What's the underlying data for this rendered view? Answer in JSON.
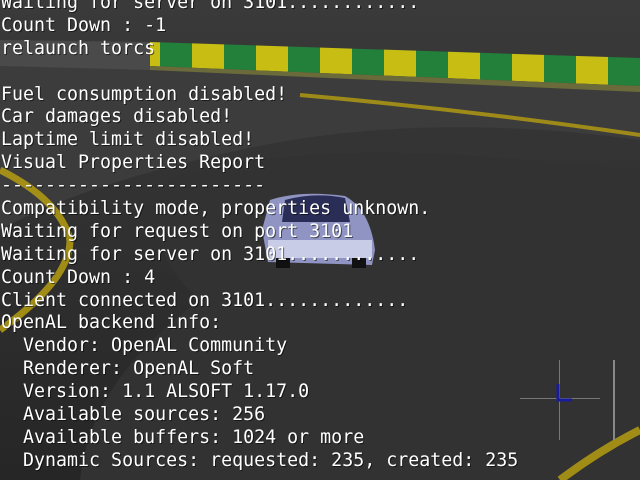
{
  "console": {
    "lines": [
      "Waiting for server on 3101............",
      "Count Down : -1",
      "relaunch torcs",
      "",
      "Fuel consumption disabled!",
      "Car damages disabled!",
      "Laptime limit disabled!",
      "Visual Properties Report",
      "------------------------",
      "Compatibility mode, properties unknown.",
      "Waiting for request on port 3101",
      "Waiting for server on 3101............",
      "Count Down : 4",
      "Client connected on 3101.............",
      "OpenAL backend info:",
      "  Vendor: OpenAL Community",
      "  Renderer: OpenAL Soft",
      "  Version: 1.1 ALSOFT 1.17.0",
      "  Available sources: 256",
      "  Available buffers: 1024 or more",
      "  Dynamic Sources: requested: 235, created: 235"
    ]
  },
  "colors": {
    "asphalt": "#2e2e2e",
    "track_line": "#c9b400",
    "barrier_yellow": "#d1c400",
    "barrier_green": "#1f8a3a",
    "console_text": "#ffffff",
    "car_body": "#9aa0c8"
  }
}
